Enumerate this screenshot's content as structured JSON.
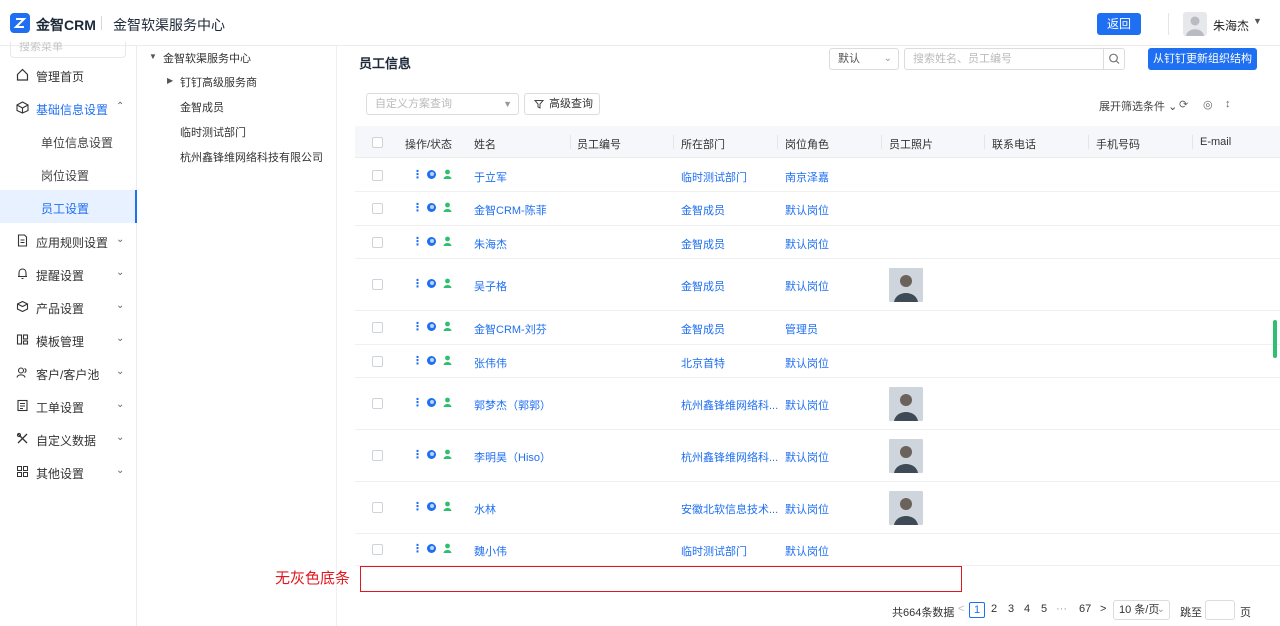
{
  "header": {
    "brand": "金智CRM",
    "app_title": "金智软渠服务中心",
    "back_label": "返回",
    "user_name": "朱海杰"
  },
  "sidebar": {
    "search_placeholder": "搜索菜单",
    "items": [
      {
        "label": "管理首页",
        "icon": "home-icon"
      },
      {
        "label": "基础信息设置",
        "icon": "cube-icon"
      },
      {
        "label": "应用规则设置",
        "icon": "doc-icon"
      },
      {
        "label": "提醒设置",
        "icon": "bell-icon"
      },
      {
        "label": "产品设置",
        "icon": "box-icon"
      },
      {
        "label": "模板管理",
        "icon": "template-icon"
      },
      {
        "label": "客户/客户池",
        "icon": "customer-icon"
      },
      {
        "label": "工单设置",
        "icon": "ticket-icon"
      },
      {
        "label": "自定义数据",
        "icon": "tools-icon"
      },
      {
        "label": "其他设置",
        "icon": "grid-icon"
      }
    ],
    "sub_items": [
      "单位信息设置",
      "岗位设置",
      "员工设置"
    ]
  },
  "tree": {
    "root": "金智软渠服务中心",
    "children": [
      "钉钉高级服务商",
      "金智成员",
      "临时测试部门",
      "杭州鑫锋维网络科技有限公司"
    ]
  },
  "main": {
    "title": "员工信息",
    "default_select": "默认",
    "search_placeholder": "搜索姓名、员工编号",
    "sync_button": "从钉钉更新组织结构",
    "scheme_placeholder": "自定义方案查询",
    "advanced_query": "高级查询",
    "expand_filter": "展开筛选条件"
  },
  "table": {
    "columns": [
      "操作/状态",
      "姓名",
      "员工编号",
      "所在部门",
      "岗位角色",
      "员工照片",
      "联系电话",
      "手机号码",
      "E-mail"
    ],
    "rows": [
      {
        "name": "于立军",
        "dept": "临时测试部门",
        "role": "南京泽嘉",
        "photo": false
      },
      {
        "name": "金智CRM-陈菲",
        "dept": "金智成员",
        "role": "默认岗位",
        "photo": false
      },
      {
        "name": "朱海杰",
        "dept": "金智成员",
        "role": "默认岗位",
        "photo": false
      },
      {
        "name": "吴子格",
        "dept": "金智成员",
        "role": "默认岗位",
        "photo": true
      },
      {
        "name": "金智CRM-刘芬",
        "dept": "金智成员",
        "role": "管理员",
        "photo": false
      },
      {
        "name": "张伟伟",
        "dept": "北京首特",
        "role": "默认岗位",
        "photo": false
      },
      {
        "name": "郭梦杰（郭郭）",
        "dept": "杭州鑫锋维网络科...",
        "role": "默认岗位",
        "photo": true
      },
      {
        "name": "李明昊（Hiso）",
        "dept": "杭州鑫锋维网络科...",
        "role": "默认岗位",
        "photo": true
      },
      {
        "name": "水林",
        "dept": "安徽北软信息技术...",
        "role": "默认岗位",
        "photo": true
      },
      {
        "name": "魏小伟",
        "dept": "临时测试部门",
        "role": "默认岗位",
        "photo": false
      }
    ]
  },
  "annotation": {
    "text": "无灰色底条",
    "color": "#e0181f"
  },
  "pagination": {
    "total": "共664条数据",
    "pages": [
      "1",
      "2",
      "3",
      "4",
      "5",
      "···",
      "67"
    ],
    "per_page": "10 条/页",
    "jump_label": "跳至",
    "page_suffix": "页"
  },
  "colors": {
    "accent": "#1f6ff2",
    "status_green": "#2fbf71"
  }
}
